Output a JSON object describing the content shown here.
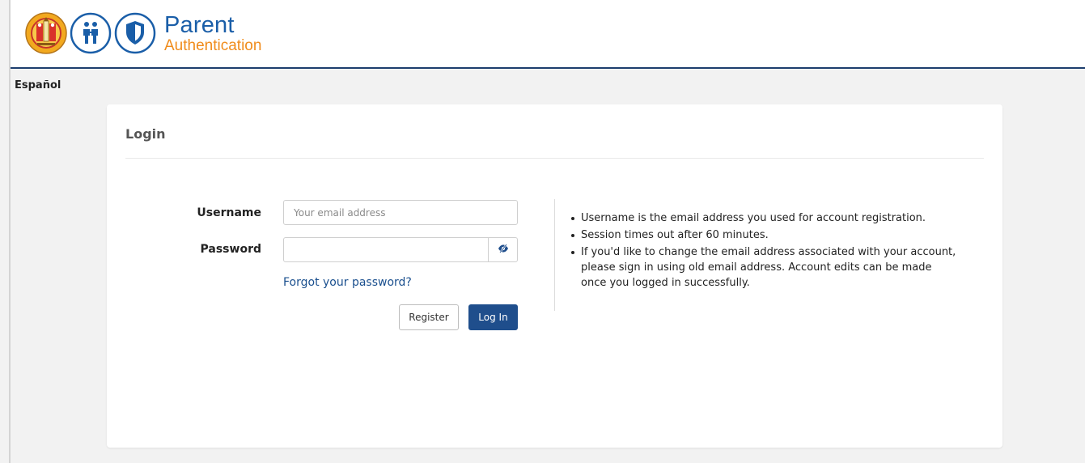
{
  "header": {
    "brand_title": "Parent",
    "brand_subtitle": "Authentication",
    "logos": [
      "district-seal-icon",
      "family-icon",
      "shield-icon"
    ]
  },
  "language_link": "Español",
  "login": {
    "title": "Login",
    "username_label": "Username",
    "username_placeholder": "Your email address",
    "username_value": "",
    "password_label": "Password",
    "password_value": "",
    "show_password_icon": "eye-slash-icon",
    "forgot_link": "Forgot your password?",
    "register_label": "Register",
    "login_label": "Log In"
  },
  "info": {
    "items": [
      "Username is the email address you used for account registration.",
      "Session times out after 60 minutes.",
      "If you'd like to change the email address associated with your account, please sign in using old email address. Account edits can be made once you logged in successfully."
    ]
  },
  "colors": {
    "brand_blue": "#1a5ea8",
    "brand_orange": "#f08c1c",
    "header_rule": "#1d3e6e",
    "primary_button": "#1f4e8c",
    "link": "#1a4f8e",
    "background": "#f2f2f2"
  }
}
